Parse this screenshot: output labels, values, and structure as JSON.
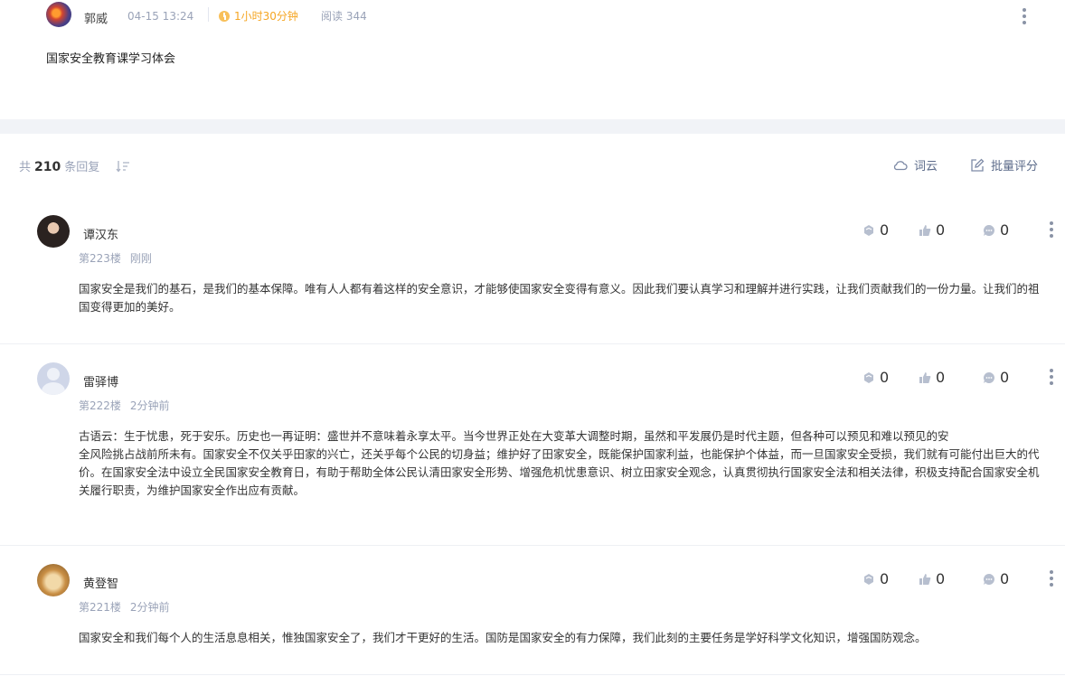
{
  "post": {
    "author": "郭威",
    "time": "04-15 13:24",
    "duration": "1小时30分钟",
    "reads": "阅读 344",
    "title": "国家安全教育课学习体会"
  },
  "reply_bar": {
    "prefix": "共",
    "count": "210",
    "suffix": "条回复",
    "word_cloud_label": "词云",
    "batch_grade_label": "批量评分"
  },
  "replies": [
    {
      "name": "谭汉东",
      "floor": "第223楼",
      "time": "刚刚",
      "awards": "0",
      "likes": "0",
      "comments": "0",
      "text": [
        "国家安全是我们的基石，是我们的基本保障。唯有人人都有着这样的安全意识，才能够使国家安全变得有意义。因此我们要认真学习和理解并进行实践，让我们贡献我们的一份力量。让我们的祖国变得更加的美好。"
      ]
    },
    {
      "name": "雷驿博",
      "floor": "第222楼",
      "time": "2分钟前",
      "awards": "0",
      "likes": "0",
      "comments": "0",
      "text": [
        "古语云：生于忧患，死于安乐。历史也一再证明：盛世并不意味着永享太平。当今世界正处在大变革大调整时期，虽然和平发展仍是时代主题，但各种可以预见和难以预见的安",
        "全风险挑占战前所未有。国家安全不仅关乎田家的兴亡，还关乎每个公民的切身益；维护好了田家安全，既能保护国家利益，也能保护个体益，而一旦国家安全受损，我们就有可能付出巨大的代价。在国家安全法中设立全民国家安全教育日，有助于帮助全体公民认清田家安全形势、增强危机忧患意识、树立田家安全观念，认真贯彻执行国家安全法和相关法律，积极支持配合国家安全机关履行职责，为维护国家安全作出应有贡献。"
      ]
    },
    {
      "name": "黄登智",
      "floor": "第221楼",
      "time": "2分钟前",
      "awards": "0",
      "likes": "0",
      "comments": "0",
      "text": [
        "国家安全和我们每个人的生活息息相关，惟独国家安全了，我们才干更好的生活。国防是国家安全的有力保障，我们此刻的主要任务是学好科学文化知识，增强国防观念。"
      ]
    }
  ],
  "icons": {
    "duration": "clock-icon",
    "sort": "sort-icon",
    "word_cloud": "cloud-icon",
    "batch_grade": "edit-icon",
    "award": "medal-icon",
    "like": "thumbs-up-icon",
    "comment": "chat-bubble-icon",
    "more": "more-vertical-icon"
  },
  "colors": {
    "accent_orange": "#f5a623",
    "muted": "#9aa3b8",
    "tool_text": "#5c6b8a",
    "band": "#f1f3f7"
  }
}
